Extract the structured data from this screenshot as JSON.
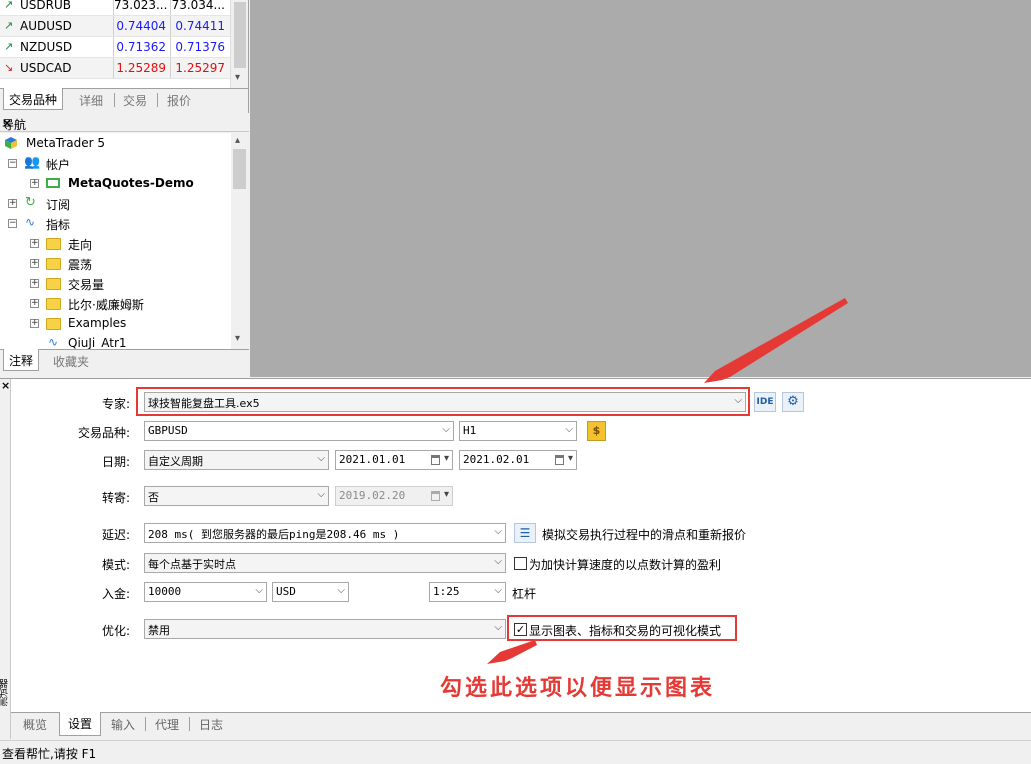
{
  "market_watch": {
    "rows": [
      {
        "symbol": "USDRUB",
        "bid": "73.023...",
        "ask": "73.034...",
        "direction": "up",
        "bid_color": "#000000",
        "ask_color": "#000000"
      },
      {
        "symbol": "AUDUSD",
        "bid": "0.74404",
        "ask": "0.74411",
        "direction": "up",
        "bid_color": "#1a1aff",
        "ask_color": "#1a1aff"
      },
      {
        "symbol": "NZDUSD",
        "bid": "0.71362",
        "ask": "0.71376",
        "direction": "up",
        "bid_color": "#1a1aff",
        "ask_color": "#1a1aff"
      },
      {
        "symbol": "USDCAD",
        "bid": "1.25289",
        "ask": "1.25297",
        "direction": "down",
        "bid_color": "#e01010",
        "ask_color": "#e01010"
      }
    ],
    "tabs": [
      "交易品种",
      "详细",
      "交易",
      "报价"
    ]
  },
  "navigator": {
    "title": "导航",
    "root": "MetaTrader 5",
    "accounts": "帐户",
    "account_name": "MetaQuotes-Demo",
    "subscriptions": "订阅",
    "indicators": "指标",
    "folders": [
      "走向",
      "震荡",
      "交易量",
      "比尔·威廉姆斯",
      "Examples"
    ],
    "item": "QiuJi_Atr1",
    "tabs": [
      "注释",
      "收藏夹"
    ]
  },
  "tester": {
    "expert_label": "专家:",
    "expert_value": "球技智能复盘工具.ex5",
    "ide_label": "IDE",
    "symbol_label": "交易品种:",
    "symbol_value": "GBPUSD",
    "timeframe_value": "H1",
    "date_label": "日期:",
    "date_mode": "自定义周期",
    "date_from": "2021.01.01",
    "date_to": "2021.02.01",
    "forward_label": "转寄:",
    "forward_value": "否",
    "forward_date": "2019.02.20",
    "delay_label": "延迟:",
    "delay_value": "208 ms( 到您服务器的最后ping是208.46 ms )",
    "delay_option": "模拟交易执行过程中的滑点和重新报价",
    "model_label": "模式:",
    "model_value": "每个点基于实时点",
    "model_option": "为加快计算速度的以点数计算的盈利",
    "model_option_checked": false,
    "deposit_label": "入金:",
    "deposit_value": "10000",
    "currency_value": "USD",
    "leverage_value": "1:25",
    "leverage_label": "杠杆",
    "optimization_label": "优化:",
    "optimization_value": "禁用",
    "visual_option": "显示图表、指标和交易的可视化模式",
    "visual_option_checked": true,
    "annotation": "勾选此选项以便显示图表",
    "side_label": "测试器",
    "tabs": [
      "概览",
      "设置",
      "输入",
      "代理",
      "日志"
    ],
    "active_tab": "设置"
  },
  "status_bar": {
    "text": "查看帮忙,请按 F1"
  },
  "colors": {
    "annotation_red": "#e53935",
    "chart_background": "#ababab"
  }
}
